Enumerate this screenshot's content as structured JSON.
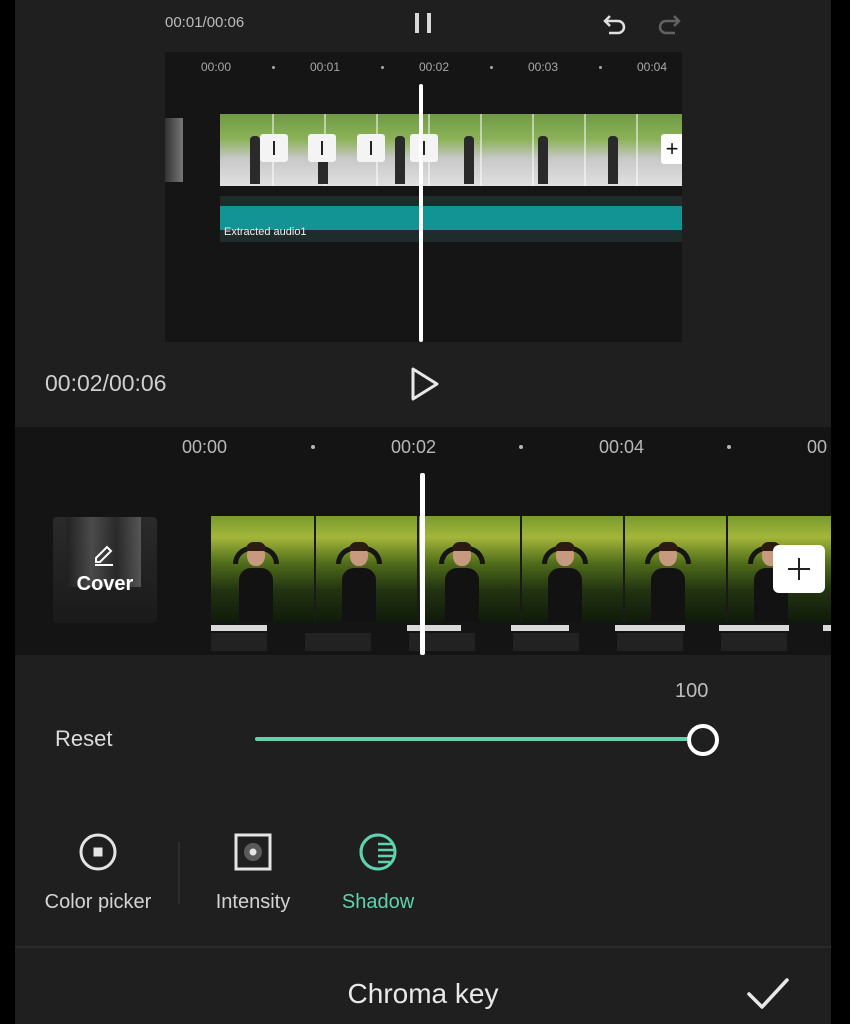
{
  "preview": {
    "time": "00:01/00:06",
    "ticks": [
      "00:00",
      "00:01",
      "00:02",
      "00:03",
      "00:04"
    ],
    "audio_label": "Extracted audio1"
  },
  "player": {
    "time": "00:02/00:06"
  },
  "timeline": {
    "ticks": [
      "00:00",
      "00:02",
      "00:04",
      "00"
    ],
    "cover_label": "Cover"
  },
  "adjust": {
    "value_label": "100",
    "value": 100,
    "max": 100,
    "reset_label": "Reset"
  },
  "tools": [
    {
      "label": "Color picker",
      "icon": "color-picker-icon"
    },
    {
      "label": "Intensity",
      "icon": "intensity-icon"
    },
    {
      "label": "Shadow",
      "icon": "shadow-icon"
    }
  ],
  "active_tool": "Shadow",
  "panel": {
    "title": "Chroma key"
  },
  "colors": {
    "accent": "#5fd2ae",
    "audio": "#129494",
    "background": "#1f1f1f"
  }
}
